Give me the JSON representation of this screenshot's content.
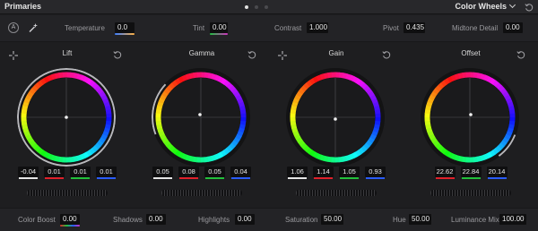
{
  "header": {
    "title": "Primaries",
    "mode": "Color Wheels",
    "pages": 3,
    "active_page": 0
  },
  "top_params": {
    "auto_label": "A",
    "temperature": {
      "label": "Temperature",
      "value": "0.0"
    },
    "tint": {
      "label": "Tint",
      "value": "0.00"
    },
    "contrast": {
      "label": "Contrast",
      "value": "1.000"
    },
    "pivot": {
      "label": "Pivot",
      "value": "0.435"
    },
    "midtone_detail": {
      "label": "Midtone Detail",
      "value": "0.00"
    }
  },
  "wheels": [
    {
      "title": "Lift",
      "values": [
        "-0.04",
        "0.01",
        "0.01",
        "0.01"
      ]
    },
    {
      "title": "Gamma",
      "values": [
        "0.05",
        "0.08",
        "0.05",
        "0.04"
      ]
    },
    {
      "title": "Gain",
      "values": [
        "1.06",
        "1.14",
        "1.05",
        "0.93"
      ]
    },
    {
      "title": "Offset",
      "values": [
        "22.62",
        "22.84",
        "20.14"
      ]
    }
  ],
  "bottom_params": {
    "color_boost": {
      "label": "Color Boost",
      "value": "0.00"
    },
    "shadows": {
      "label": "Shadows",
      "value": "0.00"
    },
    "highlights": {
      "label": "Highlights",
      "value": "0.00"
    },
    "saturation": {
      "label": "Saturation",
      "value": "50.00"
    },
    "hue": {
      "label": "Hue",
      "value": "50.00"
    },
    "luminance_mix": {
      "label": "Luminance Mix",
      "value": "100.00"
    }
  },
  "colors": {
    "master": "#e6e6e6",
    "red": "#e0202a",
    "green": "#22c03a",
    "blue": "#2a5cff"
  },
  "icons": [
    "auto-balance-icon",
    "magic-wand-icon",
    "reset-icon",
    "crosshair-picker-icon",
    "chevron-down-icon"
  ]
}
